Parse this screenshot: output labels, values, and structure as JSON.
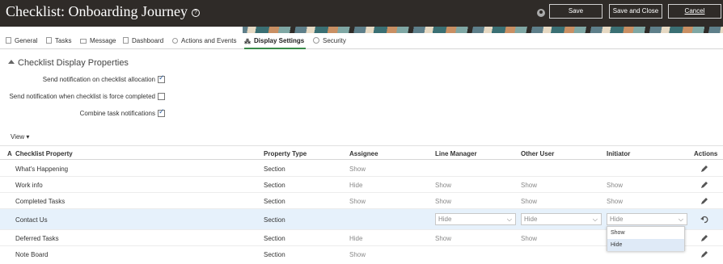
{
  "header": {
    "title": "Checklist: Onboarding Journey",
    "save_label": "Save",
    "save_close_label": "Save and Close",
    "cancel_label": "Cancel"
  },
  "tabs": [
    {
      "label": "General",
      "icon": "document-icon"
    },
    {
      "label": "Tasks",
      "icon": "tasks-icon"
    },
    {
      "label": "Message",
      "icon": "message-icon"
    },
    {
      "label": "Dashboard",
      "icon": "dashboard-icon"
    },
    {
      "label": "Actions and Events",
      "icon": "actions-icon"
    },
    {
      "label": "Display Settings",
      "icon": "display-settings-icon",
      "active": true
    },
    {
      "label": "Security",
      "icon": "security-icon"
    }
  ],
  "section": {
    "title": "Checklist Display Properties",
    "flags": [
      {
        "label": "Send notification on checklist allocation",
        "checked": true
      },
      {
        "label": "Send notification when checklist is force completed",
        "checked": false
      },
      {
        "label": "Combine task notifications",
        "checked": true
      }
    ]
  },
  "view_menu": "View ▾",
  "table": {
    "columns": [
      "A",
      "Checklist Property",
      "Property Type",
      "Assignee",
      "Line Manager",
      "Other User",
      "Initiator",
      "Actions"
    ],
    "rows": [
      {
        "property": "What's Happening",
        "type": "Section",
        "assignee": "Show",
        "line_manager": "",
        "other_user": "",
        "initiator": ""
      },
      {
        "property": "Work info",
        "type": "Section",
        "assignee": "Hide",
        "line_manager": "Show",
        "other_user": "Show",
        "initiator": "Show"
      },
      {
        "property": "Completed Tasks",
        "type": "Section",
        "assignee": "Show",
        "line_manager": "Show",
        "other_user": "Show",
        "initiator": "Show"
      },
      {
        "property": "Contact Us",
        "type": "Section",
        "assignee": "",
        "line_manager": "Hide",
        "other_user": "Hide",
        "initiator": "Hide",
        "editing": true
      },
      {
        "property": "Deferred Tasks",
        "type": "Section",
        "assignee": "Hide",
        "line_manager": "Show",
        "other_user": "Show",
        "initiator": ""
      },
      {
        "property": "Note Board",
        "type": "Section",
        "assignee": "Show",
        "line_manager": "",
        "other_user": "",
        "initiator": ""
      }
    ]
  },
  "dropdown": {
    "options": [
      "Show",
      "Hide"
    ],
    "highlighted": "Hide"
  },
  "colors": {
    "header_bg": "#2f2b28",
    "active_tab_underline": "#3a8b4a",
    "selected_row": "#e6f1fb"
  }
}
